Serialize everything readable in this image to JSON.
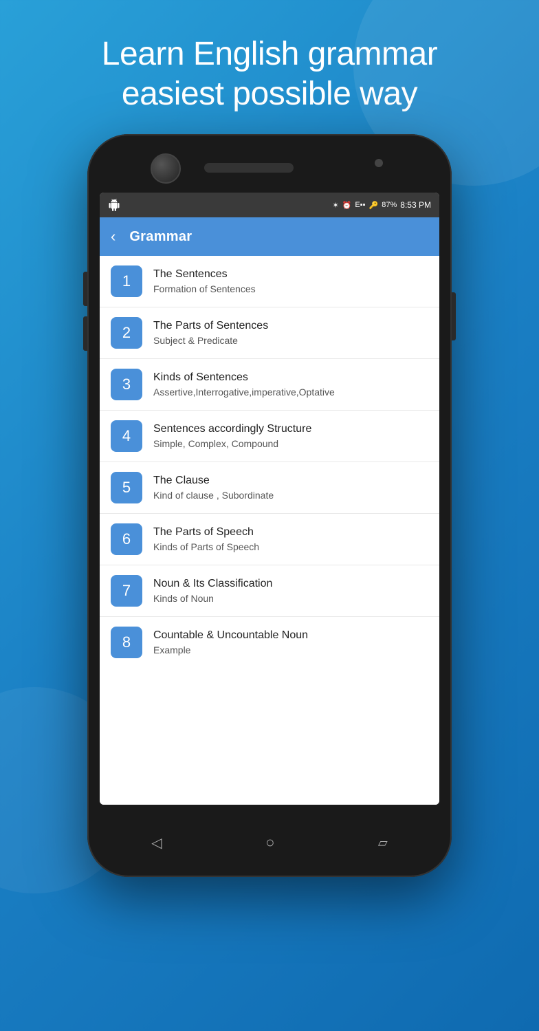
{
  "hero": {
    "line1": "Learn English grammar",
    "line2": "easiest possible way"
  },
  "statusBar": {
    "time": "8:53 PM",
    "battery": "87%",
    "signal": "E▪▪▪"
  },
  "appBar": {
    "title": "Grammar",
    "backLabel": "‹"
  },
  "listItems": [
    {
      "number": "1",
      "title": "The Sentences",
      "subtitle": "Formation of Sentences"
    },
    {
      "number": "2",
      "title": "The Parts of Sentences",
      "subtitle": "Subject & Predicate"
    },
    {
      "number": "3",
      "title": "Kinds of Sentences",
      "subtitle": "Assertive,Interrogative,imperative,Optative"
    },
    {
      "number": "4",
      "title": "Sentences accordingly Structure",
      "subtitle": "Simple, Complex, Compound"
    },
    {
      "number": "5",
      "title": "The Clause",
      "subtitle": "Kind of clause , Subordinate"
    },
    {
      "number": "6",
      "title": "The Parts of Speech",
      "subtitle": "Kinds of Parts of Speech"
    },
    {
      "number": "7",
      "title": "Noun & Its Classification",
      "subtitle": "Kinds of Noun"
    },
    {
      "number": "8",
      "title": "Countable & Uncountable Noun",
      "subtitle": "Example"
    }
  ]
}
